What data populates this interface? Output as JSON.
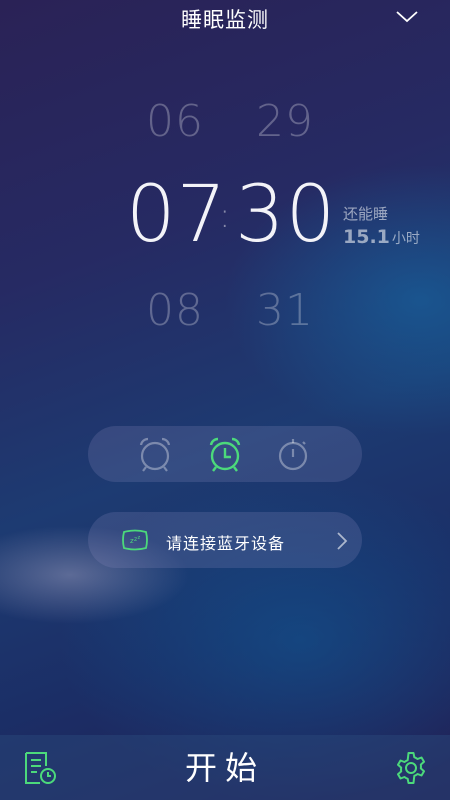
{
  "header": {
    "title": "睡眠监测",
    "collapse_icon": "chevron-down-icon"
  },
  "time_picker": {
    "hour_prev": "06",
    "minute_prev": "29",
    "hour": "07",
    "separator": ":",
    "minute": "30",
    "hour_next": "08",
    "minute_next": "31"
  },
  "remaining": {
    "label": "还能睡",
    "value": "15.1",
    "unit": "小时"
  },
  "modes": {
    "items": [
      {
        "icon": "alarm-clock-icon",
        "selected": false
      },
      {
        "icon": "alarm-clock-selected-icon",
        "selected": true
      },
      {
        "icon": "stopwatch-icon",
        "selected": false
      }
    ],
    "accent_color": "#4cd97b"
  },
  "bluetooth": {
    "icon": "pillow-zzz-icon",
    "label": "请连接蓝牙设备",
    "arrow_icon": "chevron-right-icon"
  },
  "bottom_bar": {
    "history_icon": "sleep-report-icon",
    "start_label": "开始",
    "settings_icon": "gear-icon"
  }
}
